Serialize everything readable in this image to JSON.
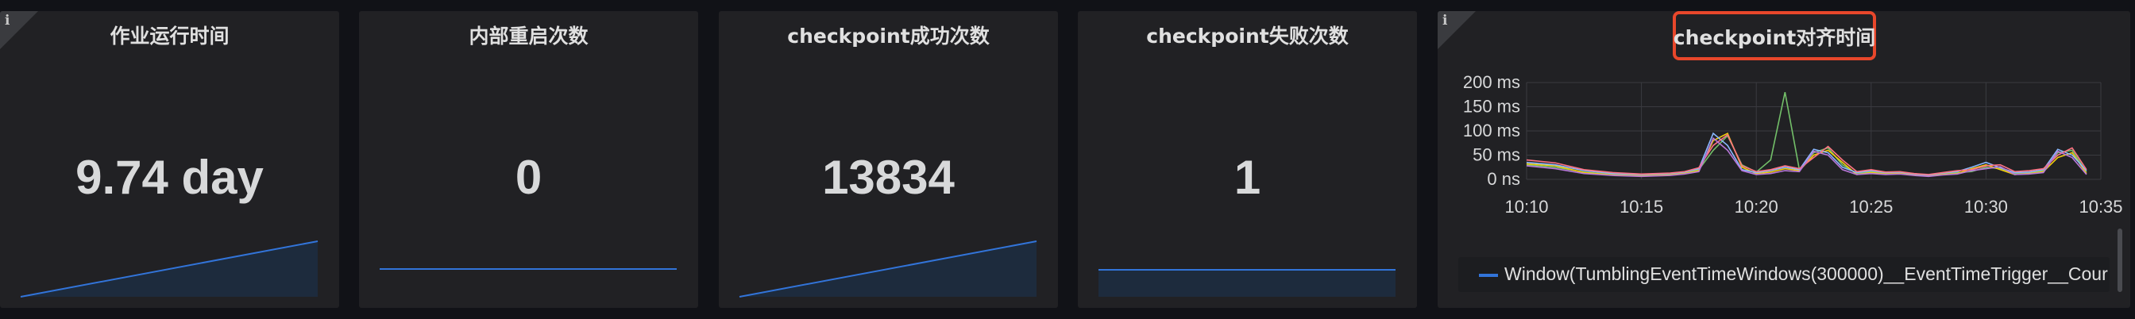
{
  "panels": [
    {
      "title": "作业运行时间",
      "value": "9.74 day",
      "spark": "rising"
    },
    {
      "title": "内部重启次数",
      "value": "0",
      "spark": "flat"
    },
    {
      "title": "checkpoint成功次数",
      "value": "13834",
      "spark": "rising"
    },
    {
      "title": "checkpoint失败次数",
      "value": "1",
      "spark": "flat"
    }
  ],
  "chart_panel": {
    "title": "checkpoint对齐时间",
    "info_icon": "i",
    "legend_label": "Window(TumblingEventTimeWindows(300000)__EventTimeTrigger__Cour",
    "legend_color": "#3274d9"
  },
  "info_icon": "i",
  "colors": {
    "background": "#111217",
    "panel": "#212124",
    "spark_line": "#3274d9",
    "spark_fill": "#1d2b3d",
    "highlight": "#e8472b"
  },
  "chart_data": {
    "type": "line",
    "title": "checkpoint对齐时间",
    "x_ticks": [
      "10:10",
      "10:15",
      "10:20",
      "10:25",
      "10:30",
      "10:35"
    ],
    "y_ticks": [
      "0 ns",
      "50 ms",
      "100 ms",
      "150 ms",
      "200 ms"
    ],
    "ylim": [
      0,
      200
    ],
    "y_unit": "ms",
    "grid": true,
    "legend_position": "bottom",
    "series": [
      {
        "color": "#73bf69",
        "x": [
          0,
          2,
          4,
          6,
          8,
          10,
          11,
          12,
          13,
          14,
          15,
          16,
          17,
          18,
          19,
          20,
          21,
          22,
          23,
          24,
          25,
          26,
          27,
          28,
          29,
          30,
          31,
          32,
          33,
          34,
          35,
          36,
          37,
          38,
          39
        ],
        "values": [
          30,
          25,
          15,
          10,
          8,
          10,
          14,
          20,
          60,
          90,
          30,
          15,
          40,
          180,
          20,
          55,
          65,
          30,
          12,
          16,
          12,
          14,
          10,
          8,
          12,
          14,
          16,
          25,
          22,
          12,
          14,
          18,
          55,
          60,
          15
        ]
      },
      {
        "color": "#f2cc0c",
        "x": [
          0,
          2,
          4,
          6,
          8,
          10,
          11,
          12,
          13,
          14,
          15,
          16,
          17,
          18,
          19,
          20,
          21,
          22,
          23,
          24,
          25,
          26,
          27,
          28,
          29,
          30,
          31,
          32,
          33,
          34,
          35,
          36,
          37,
          38,
          39
        ],
        "values": [
          32,
          28,
          14,
          9,
          7,
          9,
          12,
          18,
          80,
          95,
          25,
          12,
          15,
          22,
          18,
          50,
          60,
          35,
          10,
          14,
          11,
          12,
          9,
          7,
          10,
          12,
          22,
          30,
          20,
          10,
          12,
          16,
          45,
          55,
          12
        ]
      },
      {
        "color": "#8ab8ff",
        "x": [
          0,
          2,
          4,
          6,
          8,
          10,
          11,
          12,
          13,
          14,
          15,
          16,
          17,
          18,
          19,
          20,
          21,
          22,
          23,
          24,
          25,
          26,
          27,
          28,
          29,
          30,
          31,
          32,
          33,
          34,
          35,
          36,
          37,
          38,
          39
        ],
        "values": [
          35,
          30,
          18,
          12,
          10,
          12,
          15,
          22,
          95,
          70,
          20,
          14,
          18,
          25,
          20,
          62,
          55,
          25,
          14,
          18,
          14,
          15,
          11,
          9,
          13,
          16,
          25,
          35,
          24,
          14,
          15,
          20,
          62,
          50,
          18
        ]
      },
      {
        "color": "#ff7383",
        "x": [
          0,
          2,
          4,
          6,
          8,
          10,
          11,
          12,
          13,
          14,
          15,
          16,
          17,
          18,
          19,
          20,
          21,
          22,
          23,
          24,
          25,
          26,
          27,
          28,
          29,
          30,
          31,
          32,
          33,
          34,
          35,
          36,
          37,
          38,
          39
        ],
        "values": [
          40,
          34,
          20,
          14,
          11,
          13,
          16,
          24,
          70,
          92,
          28,
          16,
          20,
          28,
          22,
          45,
          68,
          40,
          16,
          20,
          15,
          16,
          12,
          10,
          14,
          18,
          20,
          28,
          30,
          16,
          18,
          22,
          50,
          65,
          20
        ]
      },
      {
        "color": "#b877d9",
        "x": [
          0,
          2,
          4,
          6,
          8,
          10,
          11,
          12,
          13,
          14,
          15,
          16,
          17,
          18,
          19,
          20,
          21,
          22,
          23,
          24,
          25,
          26,
          27,
          28,
          29,
          30,
          31,
          32,
          33,
          34,
          35,
          36,
          37,
          38,
          39
        ],
        "values": [
          28,
          22,
          12,
          8,
          6,
          8,
          11,
          16,
          85,
          60,
          18,
          10,
          12,
          18,
          16,
          58,
          50,
          20,
          10,
          12,
          10,
          11,
          8,
          6,
          9,
          11,
          18,
          22,
          26,
          10,
          11,
          14,
          58,
          45,
          10
        ]
      }
    ]
  }
}
